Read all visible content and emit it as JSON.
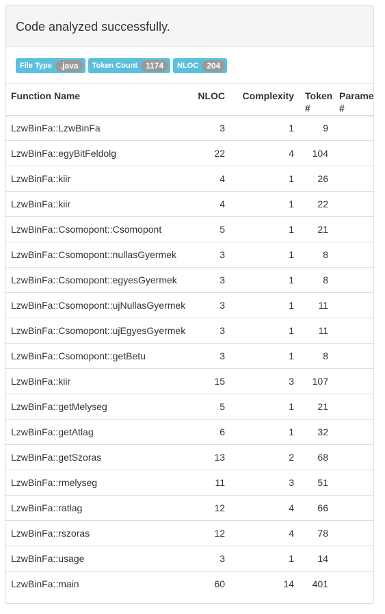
{
  "panel": {
    "heading": "Code analyzed successfully."
  },
  "badges": [
    {
      "name": "File Type",
      "value": ".java"
    },
    {
      "name": "Token Count",
      "value": "1174"
    },
    {
      "name": "NLOC",
      "value": "204"
    }
  ],
  "table": {
    "headers": {
      "function_name": "Function Name",
      "nloc": "NLOC",
      "complexity": "Complexity",
      "token": "Token #",
      "parameter": "Parameter #"
    },
    "rows": [
      {
        "name": "LzwBinFa::LzwBinFa",
        "nloc": "3",
        "complexity": "1",
        "token": "9"
      },
      {
        "name": "LzwBinFa::egyBitFeldolg",
        "nloc": "22",
        "complexity": "4",
        "token": "104"
      },
      {
        "name": "LzwBinFa::kiir",
        "nloc": "4",
        "complexity": "1",
        "token": "26"
      },
      {
        "name": "LzwBinFa::kiir",
        "nloc": "4",
        "complexity": "1",
        "token": "22"
      },
      {
        "name": "LzwBinFa::Csomopont::Csomopont",
        "nloc": "5",
        "complexity": "1",
        "token": "21"
      },
      {
        "name": "LzwBinFa::Csomopont::nullasGyermek",
        "nloc": "3",
        "complexity": "1",
        "token": "8"
      },
      {
        "name": "LzwBinFa::Csomopont::egyesGyermek",
        "nloc": "3",
        "complexity": "1",
        "token": "8"
      },
      {
        "name": "LzwBinFa::Csomopont::ujNullasGyermek",
        "nloc": "3",
        "complexity": "1",
        "token": "11"
      },
      {
        "name": "LzwBinFa::Csomopont::ujEgyesGyermek",
        "nloc": "3",
        "complexity": "1",
        "token": "11"
      },
      {
        "name": "LzwBinFa::Csomopont::getBetu",
        "nloc": "3",
        "complexity": "1",
        "token": "8"
      },
      {
        "name": "LzwBinFa::kiir",
        "nloc": "15",
        "complexity": "3",
        "token": "107"
      },
      {
        "name": "LzwBinFa::getMelyseg",
        "nloc": "5",
        "complexity": "1",
        "token": "21"
      },
      {
        "name": "LzwBinFa::getAtlag",
        "nloc": "6",
        "complexity": "1",
        "token": "32"
      },
      {
        "name": "LzwBinFa::getSzoras",
        "nloc": "13",
        "complexity": "2",
        "token": "68"
      },
      {
        "name": "LzwBinFa::rmelyseg",
        "nloc": "11",
        "complexity": "3",
        "token": "51"
      },
      {
        "name": "LzwBinFa::ratlag",
        "nloc": "12",
        "complexity": "4",
        "token": "66"
      },
      {
        "name": "LzwBinFa::rszoras",
        "nloc": "12",
        "complexity": "4",
        "token": "78"
      },
      {
        "name": "LzwBinFa::usage",
        "nloc": "3",
        "complexity": "1",
        "token": "14"
      },
      {
        "name": "LzwBinFa::main",
        "nloc": "60",
        "complexity": "14",
        "token": "401"
      }
    ]
  },
  "colors": {
    "label_bg": "#5bc0de",
    "badge_bg": "#999999",
    "heading_bg": "#f5f5f5",
    "border": "#dddddd"
  }
}
